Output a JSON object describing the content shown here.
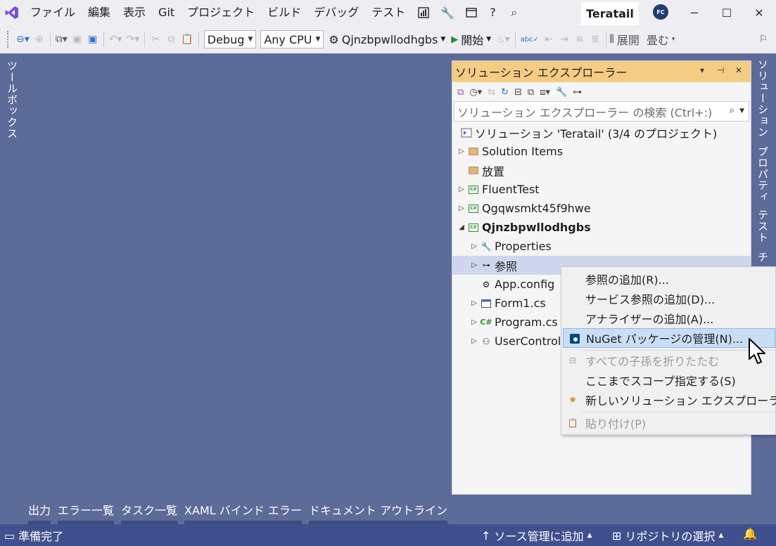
{
  "menu": {
    "items": [
      "ファイル",
      "編集",
      "表示",
      "Git",
      "プロジェクト",
      "ビルド",
      "デバッグ",
      "テスト"
    ],
    "help": "?",
    "title": "Teratail",
    "avatar": "FC"
  },
  "toolbar": {
    "configuration": "Debug",
    "platform": "Any CPU",
    "startup_project": "Qjnzbpwllodhgbs",
    "start_label": "開始",
    "expand_label": "展開",
    "collapse_label": "畳む"
  },
  "left_tab": {
    "toolbox": "ツールボックス"
  },
  "right_tabs": [
    "ソリューション",
    "プロパティ",
    "テスト",
    "チ"
  ],
  "solution_explorer": {
    "title": "ソリューション エクスプローラー",
    "search_placeholder": "ソリューション エクスプローラー の検索 (Ctrl+:)",
    "nodes": [
      {
        "label": "ソリューション 'Teratail' (3/4 のプロジェクト)"
      },
      {
        "label": "Solution Items"
      },
      {
        "label": "放置"
      },
      {
        "label": "FluentTest"
      },
      {
        "label": "Qgqwsmkt45f9hwe"
      },
      {
        "label": "Qjnzbpwllodhgbs"
      },
      {
        "label": "Properties"
      },
      {
        "label": "参照"
      },
      {
        "label": "App.config"
      },
      {
        "label": "Form1.cs"
      },
      {
        "label": "Program.cs"
      },
      {
        "label": "UserControl"
      }
    ]
  },
  "context_menu": {
    "items": [
      {
        "label": "参照の追加(R)..."
      },
      {
        "label": "サービス参照の追加(D)..."
      },
      {
        "label": "アナライザーの追加(A)..."
      },
      {
        "label": "NuGet パッケージの管理(N)..."
      },
      {
        "label": "すべての子孫を折りたたむ"
      },
      {
        "label": "ここまでスコープ指定する(S)"
      },
      {
        "label": "新しいソリューション エクスプローラー"
      },
      {
        "label": "貼り付け(P)"
      }
    ]
  },
  "bottom_tabs": [
    "出力",
    "エラー一覧",
    "タスク一覧",
    "XAML バインド エラー",
    "ドキュメント アウトライン"
  ],
  "status": {
    "ready": "準備完了",
    "source_control": "ソース管理に追加",
    "repository": "リポジトリの選択"
  }
}
